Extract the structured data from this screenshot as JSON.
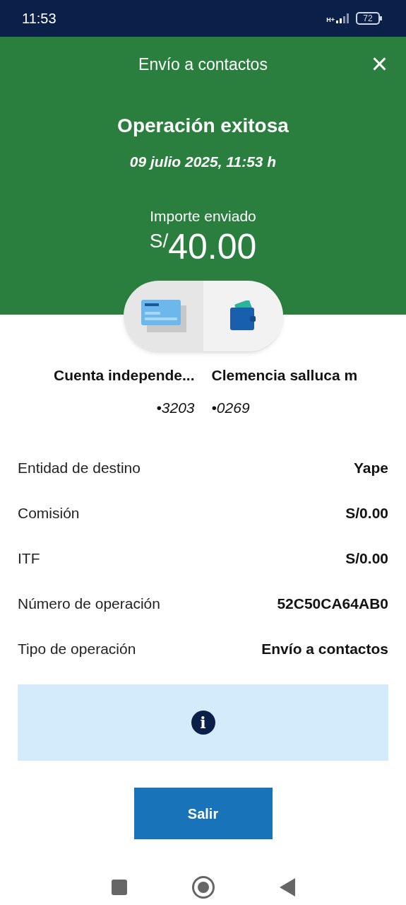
{
  "status_bar": {
    "time": "11:53",
    "network": "H+",
    "battery": "72"
  },
  "header": {
    "title": "Envío a contactos",
    "close": "×"
  },
  "result": {
    "title": "Operación exitosa",
    "date": "09 julio 2025, 11:53 h",
    "amount_label": "Importe enviado",
    "currency": "S/",
    "amount": "40.00"
  },
  "accounts": [
    {
      "name": "Cuenta independe...",
      "number": "•3203"
    },
    {
      "name": "Clemencia salluca m",
      "number": "•0269"
    }
  ],
  "details": [
    {
      "label": "Entidad de destino",
      "value": "Yape"
    },
    {
      "label": "Comisión",
      "value": "S/0.00"
    },
    {
      "label": "ITF",
      "value": "S/0.00"
    },
    {
      "label": "Número de operación",
      "value": "52C50CA64AB0"
    },
    {
      "label": "Tipo de operación",
      "value": "Envío a contactos"
    }
  ],
  "info": {
    "icon": "i"
  },
  "button": {
    "label": "Salir"
  }
}
